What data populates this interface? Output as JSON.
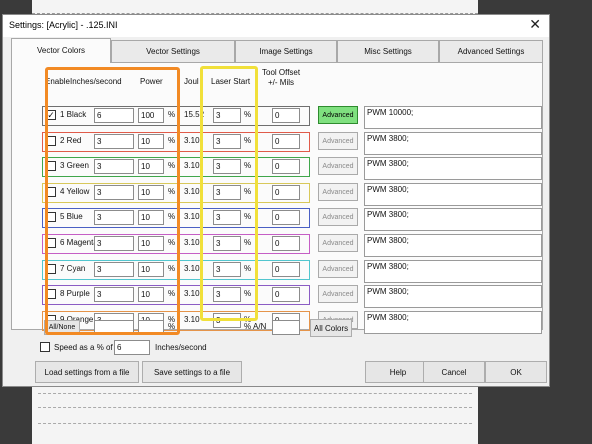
{
  "window": {
    "title": "Settings: [Acrylic] - .125.INI",
    "close_symbol": "✕"
  },
  "tabs": [
    {
      "label": "Vector Colors",
      "active": true
    },
    {
      "label": "Vector Settings",
      "active": false
    },
    {
      "label": "Image Settings",
      "active": false
    },
    {
      "label": "Misc Settings",
      "active": false
    },
    {
      "label": "Advanced Settings",
      "active": false
    }
  ],
  "headers": {
    "enable": "Enable",
    "speed": "Inches/second",
    "power": "Power",
    "joule": "Joul",
    "laser_start": "Laser Start",
    "tool_offset_1": "Tool Offset",
    "tool_offset_2": "+/- Mils"
  },
  "rows": [
    {
      "checked": true,
      "name": "1 Black",
      "color": "#6f6f6f",
      "speed": "6",
      "power": "100",
      "joule": "15.52",
      "laser_start": "3",
      "offset": "0",
      "advanced_active": true,
      "info": "PWM 10000;"
    },
    {
      "checked": false,
      "name": "2 Red",
      "color": "#e05b4a",
      "speed": "3",
      "power": "10",
      "joule": "3.10",
      "laser_start": "3",
      "offset": "0",
      "advanced_active": false,
      "info": "PWM 3800;"
    },
    {
      "checked": false,
      "name": "3 Green",
      "color": "#3fa64a",
      "speed": "3",
      "power": "10",
      "joule": "3.10",
      "laser_start": "3",
      "offset": "0",
      "advanced_active": false,
      "info": "PWM 3800;"
    },
    {
      "checked": false,
      "name": "4 Yellow",
      "color": "#d8c85a",
      "speed": "3",
      "power": "10",
      "joule": "3.10",
      "laser_start": "3",
      "offset": "0",
      "advanced_active": false,
      "info": "PWM 3800;"
    },
    {
      "checked": false,
      "name": "5 Blue",
      "color": "#4a5fc4",
      "speed": "3",
      "power": "10",
      "joule": "3.10",
      "laser_start": "3",
      "offset": "0",
      "advanced_active": false,
      "info": "PWM 3800;"
    },
    {
      "checked": false,
      "name": "6 Magenta",
      "color": "#c55ec5",
      "speed": "3",
      "power": "10",
      "joule": "3.10",
      "laser_start": "3",
      "offset": "0",
      "advanced_active": false,
      "info": "PWM 3800;"
    },
    {
      "checked": false,
      "name": "7 Cyan",
      "color": "#52c6cf",
      "speed": "3",
      "power": "10",
      "joule": "3.10",
      "laser_start": "3",
      "offset": "0",
      "advanced_active": false,
      "info": "PWM 3800;"
    },
    {
      "checked": false,
      "name": "8 Purple",
      "color": "#8b5cc4",
      "speed": "3",
      "power": "10",
      "joule": "3.10",
      "laser_start": "3",
      "offset": "0",
      "advanced_active": false,
      "info": "PWM 3800;"
    },
    {
      "checked": false,
      "name": "9 Orange",
      "color": "#e5944a",
      "speed": "3",
      "power": "10",
      "joule": "3.10",
      "laser_start": "3",
      "offset": "0",
      "advanced_active": false,
      "info": "PWM 3800;"
    }
  ],
  "labels": {
    "percent": "%",
    "advanced": "Advanced",
    "all_none": "All/None",
    "a_n": "A/N",
    "all_colors": "All Colors",
    "speed_as_pct": "Speed as a % of",
    "speed_pct_value": "6",
    "inches_second": "Inches/second"
  },
  "buttons": {
    "load": "Load settings from a file",
    "save": "Save settings to a file",
    "help": "Help",
    "cancel": "Cancel",
    "ok": "OK"
  },
  "highlight_colors": {
    "orange": "#f28a24",
    "yellow": "#f1e03a"
  }
}
